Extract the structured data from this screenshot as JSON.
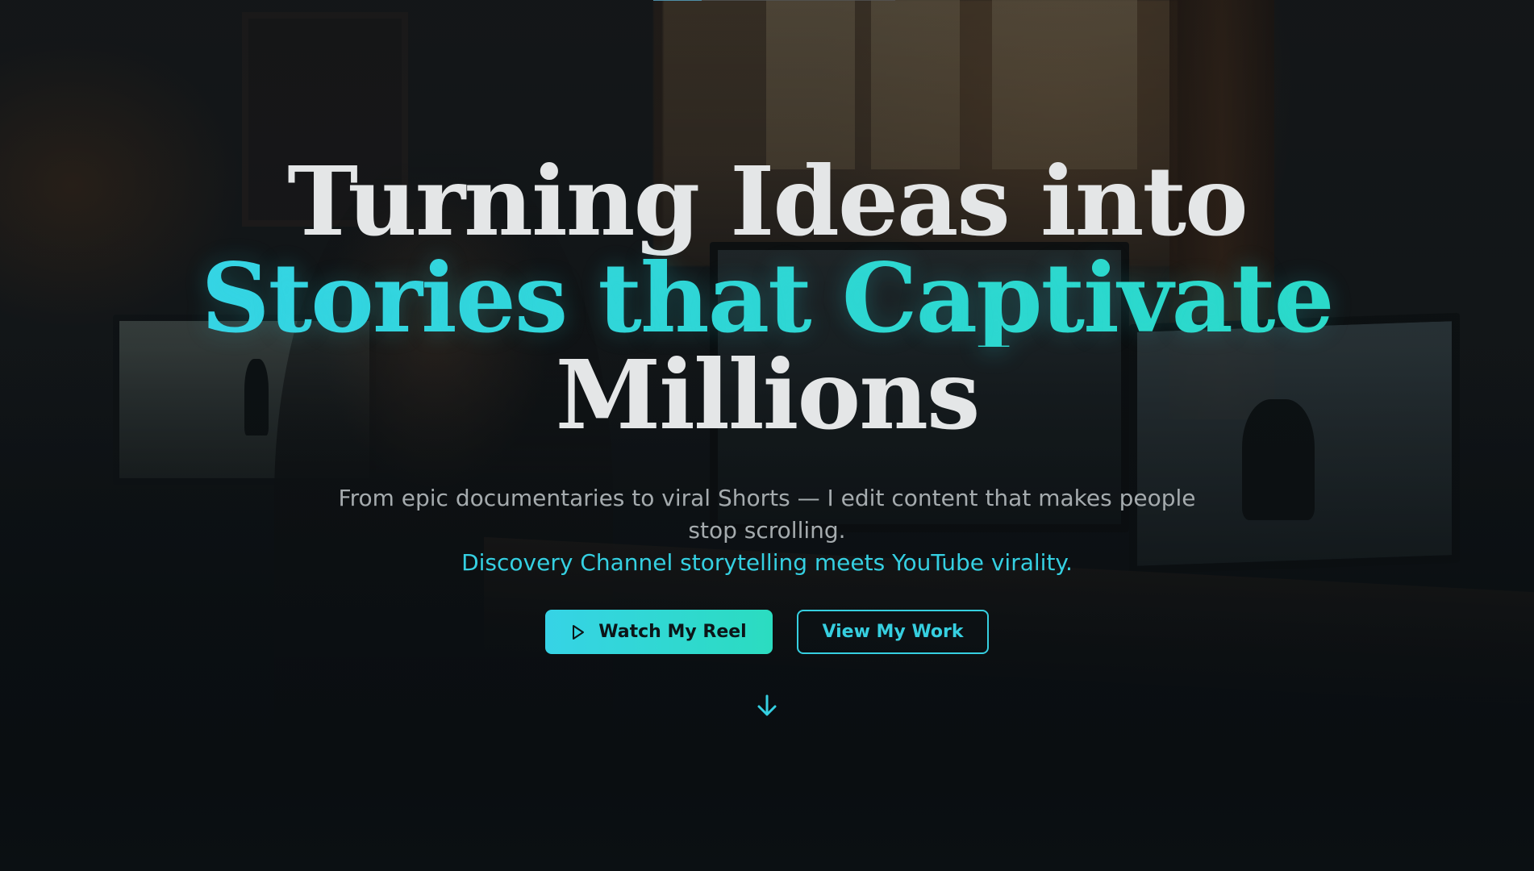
{
  "hero": {
    "headline": {
      "line1": "Turning Ideas into",
      "line2": "Stories that Captivate",
      "line3": "Millions"
    },
    "subtitle": "From epic documentaries to viral Shorts — I edit content that makes people stop scrolling.",
    "tagline": "Discovery Channel storytelling meets YouTube virality.",
    "buttons": {
      "primary_label": "Watch My Reel",
      "primary_icon": "play-icon",
      "secondary_label": "View My Work"
    },
    "scroll_icon": "arrow-down-icon"
  },
  "colors": {
    "accent": "#35d0e2",
    "accent_end": "#2bdcc4",
    "headline_text": "#e4e6e7",
    "body_text": "#a5abae",
    "background": "#0b1115"
  }
}
